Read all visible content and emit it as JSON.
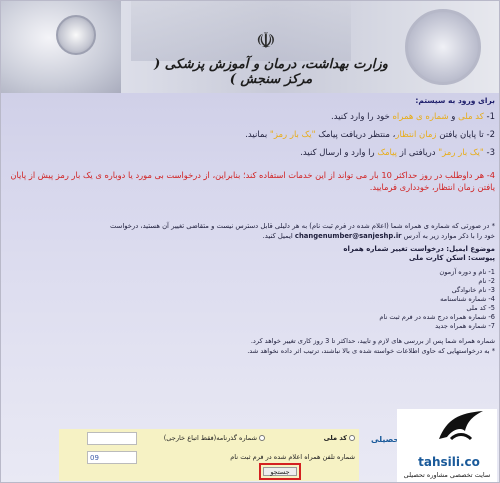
{
  "banner": {
    "title": "وزارت بهداشت، درمان و آموزش پزشکی ( مرکز سنجش )"
  },
  "intro": {
    "heading": "برای ورود به سیستم:"
  },
  "steps": [
    {
      "num": "1-",
      "pre": "",
      "hl1": "کد ملی",
      "mid": " و ",
      "hl2": "شماره ی همراه",
      "post": " خود را وارد کنید."
    },
    {
      "num": "2-",
      "pre": "تا پایان یافتن ",
      "hl1": "زمان انتظار",
      "mid": "، منتظر دریافت پیامک ",
      "hl2": "\"یک بار رمز\"",
      "post": " بمانید."
    },
    {
      "num": "3-",
      "pre": "",
      "hl1": "\"یک بار رمز\"",
      "mid": " دریافتی از ",
      "hl2": "پیامک",
      "post": " را وارد و ارسال کنید."
    }
  ],
  "warning": "4- هر داوطلب در روز حداکثر 10 بار می تواند از این خدمات استفاده کند؛ بنابراین، از درخواست بی مورد یا دوباره ی یک بار رمز پیش از پایان یافتن زمان انتظار، خودداری فرمایید.",
  "note": {
    "line1": "* در صورتی که شماره ی همراه شما (اعلام شده در فرم ثبت نام) به هر دلیلی قابل دسترس نیست و متقاضی تغییر آن هستید، درخواست",
    "line2_pre": "خود را با ذکر موارد زیر به آدرس",
    "email": "changenumber@sanjeshp.ir",
    "line2_post": "ایمیل کنید."
  },
  "subject": "موضوع ایمیل: درخواست تغییر شماره همراه",
  "attachment": "پیوست: اسکن کارت ملی",
  "list": [
    "1- نام و دوره آزمون",
    "2- نام",
    "3- نام خانوادگی",
    "4- شماره شناسنامه",
    "5- کد ملی",
    "6- شماره همراه درج شده در فرم ثبت نام",
    "7- شماره همراه جدید"
  ],
  "closing": [
    "شماره همراه شما پس از بررسی های لازم و تایید، حداکثر تا 3 روز کاری  تغییر خواهد کرد.",
    "* به درخواستهایی که حاوی اطلاعات خواسته شده ی بالا نباشند، ترتیب اثر داده نخواهد شد."
  ],
  "form": {
    "opt_national": "کد ملی",
    "opt_passport": "شماره گذرنامه(فقط اتباع خارجی)",
    "phone_label": "شماره تلفن همراه اعلام شده در فرم ثبت نام",
    "phone_value": "09",
    "id_value": "",
    "search_label": "جستجو"
  },
  "watermark": {
    "brand": "tahsili.co",
    "tagline": "سایت تخصصی مشاوره تحصیلی",
    "brand_fa": "تحصیلی"
  },
  "colors": {
    "highlight": "#e8ac16",
    "warning": "#d11f1f",
    "form_bg": "#f6f2c4",
    "button_border": "#d42121"
  }
}
